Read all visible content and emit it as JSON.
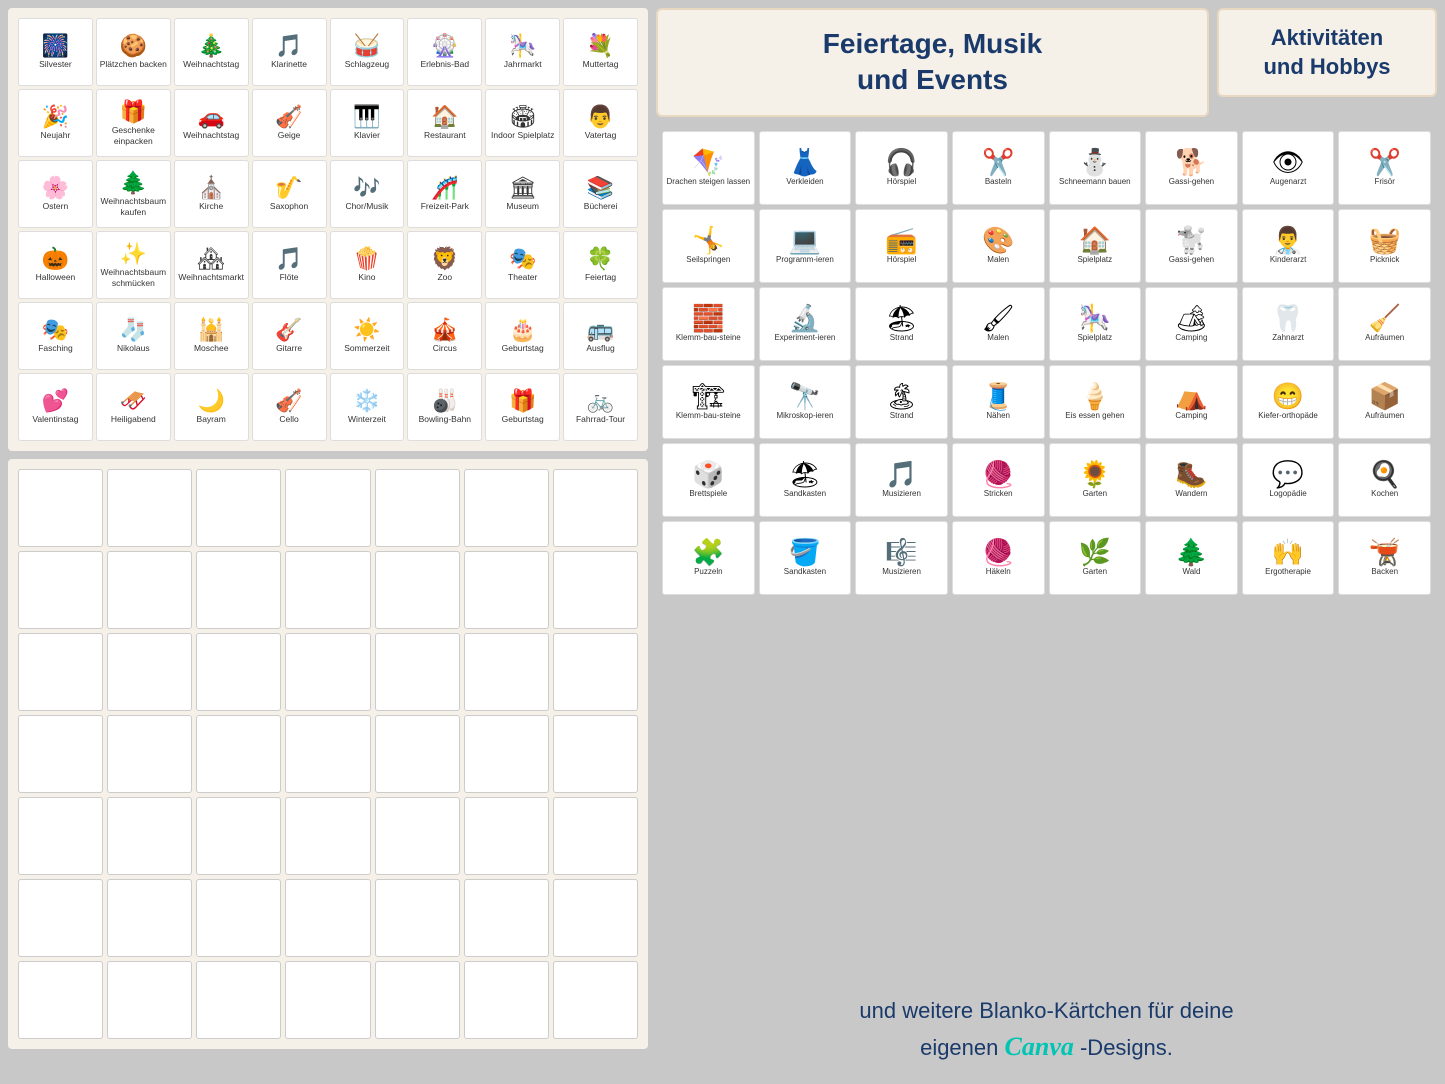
{
  "leftGrid": {
    "title": "Feiertage, Musik und Events",
    "cards": [
      {
        "label": "Silvester",
        "icon": "🎆"
      },
      {
        "label": "Plätzchen backen",
        "icon": "🍪"
      },
      {
        "label": "Weihnachtstag",
        "icon": "🎄"
      },
      {
        "label": "Klarinette",
        "icon": "🎵"
      },
      {
        "label": "Schlagzeug",
        "icon": "🥁"
      },
      {
        "label": "Erlebnis-Bad",
        "icon": "🎡"
      },
      {
        "label": "Jahrmarkt",
        "icon": "🎠"
      },
      {
        "label": "Muttertag",
        "icon": "💐"
      },
      {
        "label": "Neujahr",
        "icon": "🎉"
      },
      {
        "label": "Geschenke einpacken",
        "icon": "🎁"
      },
      {
        "label": "Weihnachtstag",
        "icon": "🚗"
      },
      {
        "label": "Geige",
        "icon": "🎻"
      },
      {
        "label": "Klavier",
        "icon": "🎹"
      },
      {
        "label": "Restaurant",
        "icon": "🏠"
      },
      {
        "label": "Indoor Spielplatz",
        "icon": "🏟"
      },
      {
        "label": "Vatertag",
        "icon": "👨"
      },
      {
        "label": "Ostern",
        "icon": "🌸"
      },
      {
        "label": "Weihnachtsbaum kaufen",
        "icon": "🌲"
      },
      {
        "label": "Kirche",
        "icon": "⛪"
      },
      {
        "label": "Saxophon",
        "icon": "🎷"
      },
      {
        "label": "Chor/Musik",
        "icon": "🎶"
      },
      {
        "label": "Freizeit-Park",
        "icon": "🎢"
      },
      {
        "label": "Museum",
        "icon": "🏛"
      },
      {
        "label": "Bücherei",
        "icon": "📚"
      },
      {
        "label": "Halloween",
        "icon": "🎃"
      },
      {
        "label": "Weihnachtsbaum schmücken",
        "icon": "✨"
      },
      {
        "label": "Weihnachtsmarkt",
        "icon": "🏘"
      },
      {
        "label": "Flöte",
        "icon": "🎵"
      },
      {
        "label": "Kino",
        "icon": "🍿"
      },
      {
        "label": "Zoo",
        "icon": "🦁"
      },
      {
        "label": "Theater",
        "icon": "🎭"
      },
      {
        "label": "Feiertag",
        "icon": "🍀"
      },
      {
        "label": "Fasching",
        "icon": "🎭"
      },
      {
        "label": "Nikolaus",
        "icon": "🧦"
      },
      {
        "label": "Moschee",
        "icon": "🕌"
      },
      {
        "label": "Gitarre",
        "icon": "🎸"
      },
      {
        "label": "Sommerzeit",
        "icon": "☀️"
      },
      {
        "label": "Circus",
        "icon": "🎪"
      },
      {
        "label": "Geburtstag",
        "icon": "🎂"
      },
      {
        "label": "Ausflug",
        "icon": "🚌"
      },
      {
        "label": "Valentinstag",
        "icon": "💕"
      },
      {
        "label": "Heiligabend",
        "icon": "🛷"
      },
      {
        "label": "Bayram",
        "icon": "🌙"
      },
      {
        "label": "Cello",
        "icon": "🎻"
      },
      {
        "label": "Winterzeit",
        "icon": "❄️"
      },
      {
        "label": "Bowling-Bahn",
        "icon": "🎳"
      },
      {
        "label": "Geburtstag",
        "icon": "🎁"
      },
      {
        "label": "Fahrrad-Tour",
        "icon": "🚲"
      }
    ]
  },
  "blankGrid": {
    "rows": 7,
    "cols": 7
  },
  "rightTitle": "Feiertage, Musik und Events",
  "subTitle": "Aktivitäten und Hobbys",
  "activitiesGrid": {
    "cards": [
      {
        "label": "Drachen steigen lassen",
        "icon": "🪁"
      },
      {
        "label": "Verkleiden",
        "icon": "👗"
      },
      {
        "label": "Hörspiel",
        "icon": "🎧"
      },
      {
        "label": "Basteln",
        "icon": "✂️"
      },
      {
        "label": "Schneemann bauen",
        "icon": "⛄"
      },
      {
        "label": "Gassi-gehen",
        "icon": "🐕"
      },
      {
        "label": "Augenarzt",
        "icon": "👁"
      },
      {
        "label": "Frisör",
        "icon": "✂️"
      },
      {
        "label": "Seilspringen",
        "icon": "🤸"
      },
      {
        "label": "Programm-ieren",
        "icon": "💻"
      },
      {
        "label": "Hörspiel",
        "icon": "📻"
      },
      {
        "label": "Malen",
        "icon": "🎨"
      },
      {
        "label": "Spielplatz",
        "icon": "🏠"
      },
      {
        "label": "Gassi-gehen",
        "icon": "🐩"
      },
      {
        "label": "Kinderarzt",
        "icon": "👨‍⚕️"
      },
      {
        "label": "Picknick",
        "icon": "🧺"
      },
      {
        "label": "Klemm-bau-steine",
        "icon": "🧱"
      },
      {
        "label": "Experiment-ieren",
        "icon": "🔬"
      },
      {
        "label": "Strand",
        "icon": "🏖"
      },
      {
        "label": "Malen",
        "icon": "🖌"
      },
      {
        "label": "Spielplatz",
        "icon": "🎠"
      },
      {
        "label": "Camping",
        "icon": "🏕"
      },
      {
        "label": "Zahnarzt",
        "icon": "🦷"
      },
      {
        "label": "Aufräumen",
        "icon": "🧹"
      },
      {
        "label": "Klemm-bau-steine",
        "icon": "🏗"
      },
      {
        "label": "Mikroskop-ieren",
        "icon": "🔭"
      },
      {
        "label": "Strand",
        "icon": "🏝"
      },
      {
        "label": "Nähen",
        "icon": "🧵"
      },
      {
        "label": "Eis essen gehen",
        "icon": "🍦"
      },
      {
        "label": "Camping",
        "icon": "⛺"
      },
      {
        "label": "Kiefer-orthopäde",
        "icon": "😁"
      },
      {
        "label": "Aufräumen",
        "icon": "📦"
      },
      {
        "label": "Brettspiele",
        "icon": "🎲"
      },
      {
        "label": "Sandkasten",
        "icon": "🏖"
      },
      {
        "label": "Musizieren",
        "icon": "🎵"
      },
      {
        "label": "Stricken",
        "icon": "🧶"
      },
      {
        "label": "Garten",
        "icon": "🌻"
      },
      {
        "label": "Wandern",
        "icon": "🥾"
      },
      {
        "label": "Logopädie",
        "icon": "💬"
      },
      {
        "label": "Kochen",
        "icon": "🍳"
      },
      {
        "label": "Puzzeln",
        "icon": "🧩"
      },
      {
        "label": "Sandkasten",
        "icon": "🪣"
      },
      {
        "label": "Musizieren",
        "icon": "🎼"
      },
      {
        "label": "Häkeln",
        "icon": "🧶"
      },
      {
        "label": "Garten",
        "icon": "🌿"
      },
      {
        "label": "Wald",
        "icon": "🌲"
      },
      {
        "label": "Ergotherapie",
        "icon": "🙌"
      },
      {
        "label": "Backen",
        "icon": "🫕"
      }
    ]
  },
  "bottomText": {
    "line1": "und weitere Blanko-Kärtchen für deine",
    "line2": "eigenen",
    "canva": "Canva",
    "line3": "-Designs."
  }
}
